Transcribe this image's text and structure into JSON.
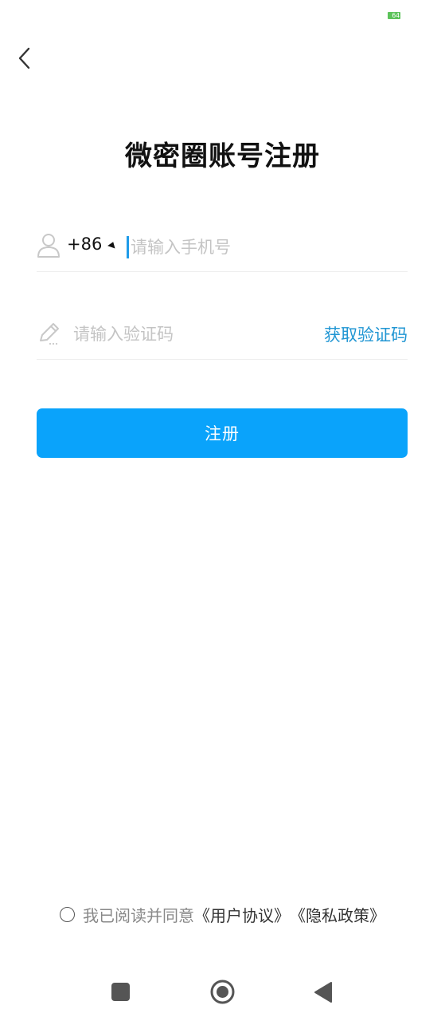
{
  "status_bar": {
    "battery": "64"
  },
  "header": {
    "title": "微密圈账号注册"
  },
  "form": {
    "country_code": "+86",
    "phone_placeholder": "请输入手机号",
    "code_placeholder": "请输入验证码",
    "get_code_label": "获取验证码",
    "register_label": "注册"
  },
  "agreement": {
    "prefix": "我已阅读并同意",
    "user_agreement": "《用户协议》",
    "privacy_policy": "《隐私政策》",
    "checked": false
  },
  "colors": {
    "accent": "#0aa3fb",
    "link": "#2196d3",
    "battery": "#5cc35a"
  },
  "icons": [
    "chevron-left-icon",
    "user-icon",
    "pencil-icon",
    "nav-square-icon",
    "nav-home-icon",
    "nav-back-icon"
  ]
}
